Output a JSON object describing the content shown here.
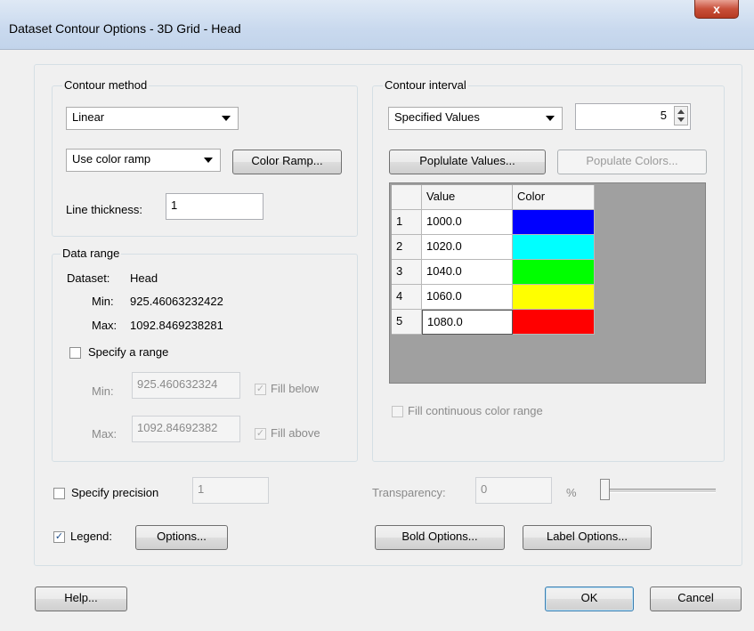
{
  "window": {
    "title": "Dataset Contour Options - 3D Grid - Head",
    "close_label": "x"
  },
  "contour_method": {
    "group_label": "Contour method",
    "method_value": "Linear",
    "ramp_mode_value": "Use color ramp",
    "color_ramp_button": "Color Ramp...",
    "line_thickness_label": "Line thickness:",
    "line_thickness_value": "1"
  },
  "data_range": {
    "group_label": "Data range",
    "dataset_label": "Dataset:",
    "dataset_value": "Head",
    "min_label": "Min:",
    "min_value": "925.46063232422",
    "max_label": "Max:",
    "max_value": "1092.8469238281",
    "specify_range_label": "Specify a range",
    "specify_range_checked": false,
    "range_min_label": "Min:",
    "range_min_value": "925.460632324",
    "range_max_label": "Max:",
    "range_max_value": "1092.84692382",
    "fill_below_label": "Fill below",
    "fill_below_checked": true,
    "fill_above_label": "Fill above",
    "fill_above_checked": true
  },
  "contour_interval": {
    "group_label": "Contour interval",
    "mode_value": "Specified Values",
    "count_value": "5",
    "populate_values_button": "Poplulate Values...",
    "populate_colors_button": "Populate Colors...",
    "table": {
      "columns": [
        "",
        "Value",
        "Color"
      ],
      "rows": [
        {
          "index": "1",
          "value": "1000.0",
          "color": "#0000ff"
        },
        {
          "index": "2",
          "value": "1020.0",
          "color": "#00ffff"
        },
        {
          "index": "3",
          "value": "1040.0",
          "color": "#00ff00"
        },
        {
          "index": "4",
          "value": "1060.0",
          "color": "#ffff00"
        },
        {
          "index": "5",
          "value": "1080.0",
          "color": "#ff0000"
        }
      ]
    },
    "fill_continuous_label": "Fill continuous color range",
    "fill_continuous_checked": false
  },
  "bottom": {
    "specify_precision_label": "Specify precision",
    "specify_precision_checked": false,
    "precision_value": "1",
    "transparency_label": "Transparency:",
    "transparency_value": "0",
    "transparency_unit": "%",
    "legend_label": "Legend:",
    "legend_checked": true,
    "legend_options_button": "Options...",
    "bold_options_button": "Bold Options...",
    "label_options_button": "Label Options..."
  },
  "footer": {
    "help_button": "Help...",
    "ok_button": "OK",
    "cancel_button": "Cancel"
  }
}
